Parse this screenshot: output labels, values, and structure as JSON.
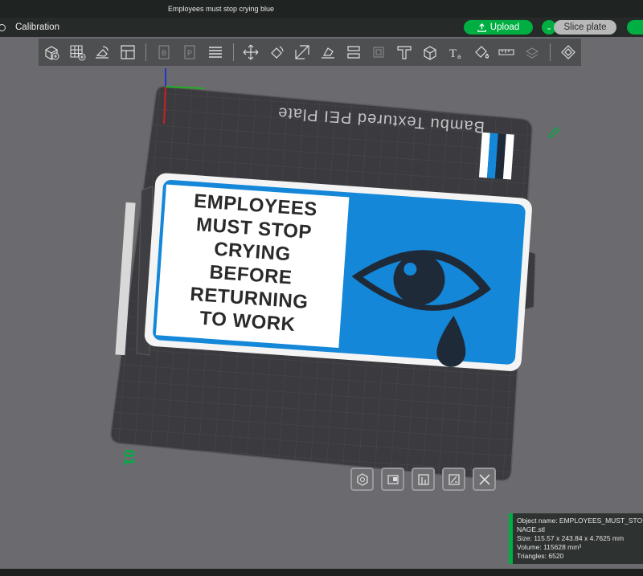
{
  "window": {
    "title": "Employees must stop crying blue"
  },
  "topbar": {
    "calibration_label": "Calibration",
    "upload_label": "Upload",
    "slice_label": "Slice plate"
  },
  "toolbar": {
    "tools": [
      "add-object-icon",
      "arrange-grid-icon",
      "orient-icon",
      "plate-layout-icon",
      "dim-tool-1-icon",
      "dim-tool-2-icon",
      "layers-icon",
      "move-icon",
      "rotate-icon",
      "scale-icon",
      "place-on-face-icon",
      "cut-icon",
      "dim-tool-3-icon",
      "support-paint-icon",
      "seam-paint-icon",
      "text-icon",
      "color-paint-icon",
      "measure-icon",
      "assembly-icon",
      "variable-layer-icon"
    ]
  },
  "viewport": {
    "bed_label": "Bambu Textured PEI Plate",
    "plate_number": "01",
    "sign_text_lines": [
      "EMPLOYEES",
      "MUST STOP",
      "CRYING",
      "BEFORE",
      "RETURNING",
      "TO WORK"
    ]
  },
  "colors": {
    "accent": "#00ae42",
    "sign_blue": "#1487d9",
    "sign_dark": "#1e2a38",
    "sign_white": "#ffffff"
  },
  "info_panel": {
    "object_name": "Object name: EMPLOYEES_MUST_STOP_CRYING_SIGNAGE.stl",
    "object_name_line2": "NAGE.stl",
    "size": "Size: 115.57 x 243.84 x 4.7625 mm",
    "volume": "Volume: 115628 mm³",
    "triangles": "Triangles: 6520"
  }
}
